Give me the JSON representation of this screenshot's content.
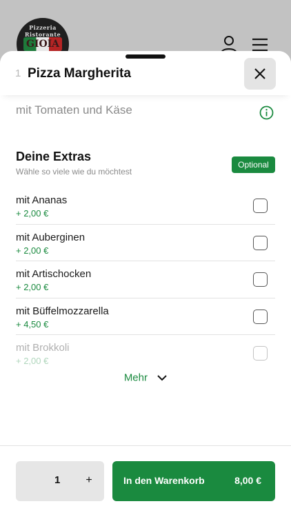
{
  "background": {
    "logo": {
      "ring_text": "Pizzeria Ristorante",
      "wordmark": "GIOIA"
    }
  },
  "product": {
    "quantity_prefix": "1",
    "title": "Pizza Margherita",
    "description": "mit Tomaten und Käse"
  },
  "extras": {
    "title": "Deine Extras",
    "subtitle": "Wähle so viele wie du möchtest",
    "badge": "Optional",
    "options": [
      {
        "name": "mit Ananas",
        "price": "+ 2,00 €"
      },
      {
        "name": "mit Auberginen",
        "price": "+ 2,00 €"
      },
      {
        "name": "mit Artischocken",
        "price": "+ 2,00 €"
      },
      {
        "name": "mit Büffelmozzarella",
        "price": "+ 4,50 €"
      },
      {
        "name": "mit Brokkoli",
        "price": "+ 2,00 €"
      }
    ],
    "more_label": "Mehr"
  },
  "footer": {
    "quantity": "1",
    "plus": "+",
    "add_to_cart": "In den Warenkorb",
    "total": "8,00 €"
  },
  "colors": {
    "accent": "#1a8a3f",
    "overlay": "#b9b9b9"
  }
}
